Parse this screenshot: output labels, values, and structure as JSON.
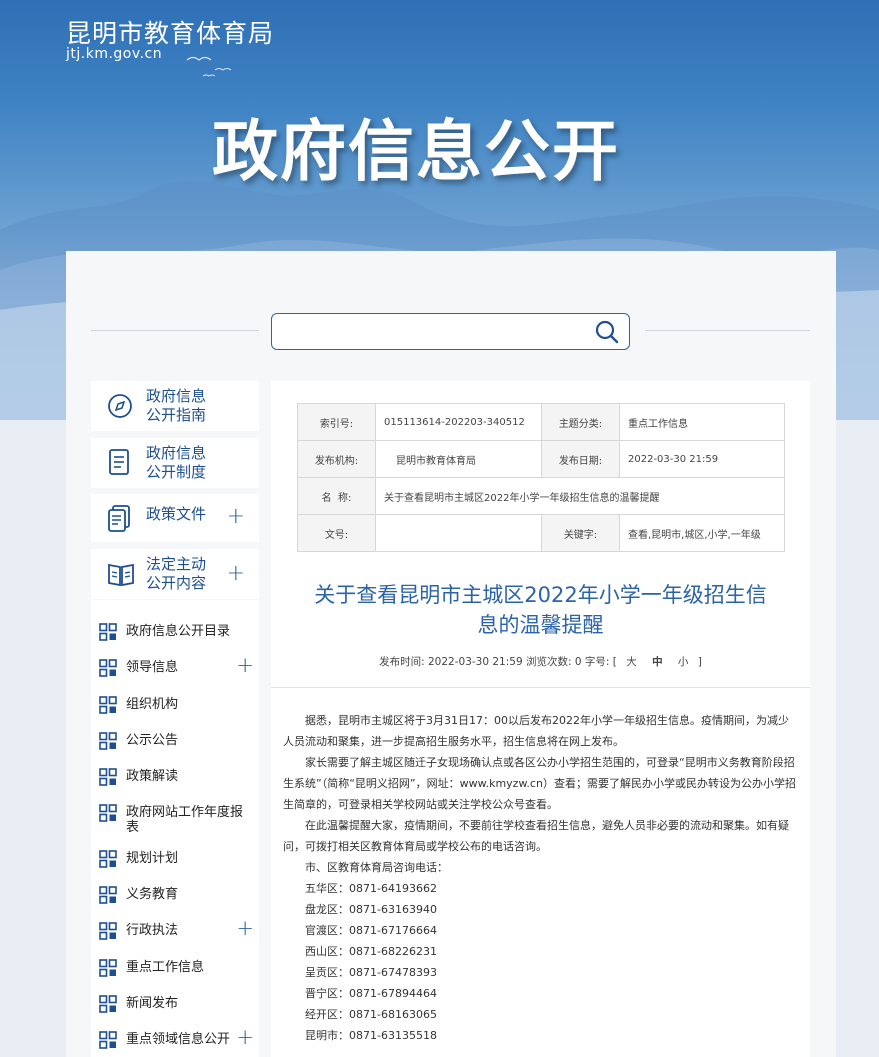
{
  "site": {
    "name": "昆明市教育体育局",
    "domain": "jtj.km.gov.cn"
  },
  "hero": {
    "title": "政府信息公开"
  },
  "search": {
    "placeholder": ""
  },
  "sidebar": {
    "cards": [
      {
        "label": "政府信息\n公开指南",
        "icon": "compass-icon",
        "has_plus": false
      },
      {
        "label": "政府信息\n公开制度",
        "icon": "document-icon",
        "has_plus": false
      },
      {
        "label": "政策文件",
        "icon": "policy-file-icon",
        "has_plus": true,
        "plus": "+"
      },
      {
        "label": "法定主动\n公开内容",
        "icon": "open-book-icon",
        "has_plus": true,
        "plus": "+"
      }
    ],
    "sub_items": [
      {
        "label": "政府信息公开目录",
        "plus": ""
      },
      {
        "label": "领导信息",
        "plus": "+"
      },
      {
        "label": "组织机构",
        "plus": ""
      },
      {
        "label": "公示公告",
        "plus": ""
      },
      {
        "label": "政策解读",
        "plus": ""
      },
      {
        "label": "政府网站工作年度报表",
        "plus": ""
      },
      {
        "label": "规划计划",
        "plus": ""
      },
      {
        "label": "义务教育",
        "plus": ""
      },
      {
        "label": "行政执法",
        "plus": "+"
      },
      {
        "label": "重点工作信息",
        "plus": ""
      },
      {
        "label": "新闻发布",
        "plus": ""
      },
      {
        "label": "重点领域信息公开",
        "plus": "+"
      }
    ]
  },
  "meta": {
    "index_label": "索引号:",
    "index_value": "015113614-202203-340512",
    "topic_label": "主题分类:",
    "topic_value": "重点工作信息",
    "org_label": "发布机构:",
    "org_value": "昆明市教育体育局",
    "date_label": "发布日期:",
    "date_value": "2022-03-30 21:59",
    "name_label": "名  称:",
    "name_value": "关于查看昆明市主城区2022年小学一年级招生信息的温馨提醒",
    "docno_label": "文号:",
    "docno_value": "",
    "keyword_label": "关键字:",
    "keyword_value": "查看,昆明市,城区,小学,一年级"
  },
  "article": {
    "title_line1": "关于查看昆明市主城区2022年小学一年级招生信",
    "title_line2": "息的温馨提醒",
    "pub_label": "发布时间:",
    "pub_time": "2022-03-30 21:59",
    "views_label": "浏览次数:",
    "views": "0",
    "fontsize_label": "字号:",
    "size_large": "大",
    "size_medium": "中",
    "size_small": "小",
    "paragraphs": [
      "据悉，昆明市主城区将于3月31日17：00以后发布2022年小学一年级招生信息。疫情期间，为减少人员流动和聚集，进一步提高招生服务水平，招生信息将在网上发布。",
      "家长需要了解主城区随迁子女现场确认点或各区公办小学招生范围的，可登录“昆明市义务教育阶段招生系统”（简称“昆明义招网”，网址：www.kmyzw.cn）查看；需要了解民办小学或民办转设为公办小学招生简章的，可登录相关学校网站或关注学校公众号查看。",
      "在此温馨提醒大家，疫情期间，不要前往学校查看招生信息，避免人员非必要的流动和聚集。如有疑问，可拨打相关区教育体育局或学校公布的电话咨询。"
    ],
    "phones_title": "市、区教育体育局咨询电话：",
    "phones": [
      "五华区：0871-64193662",
      "盘龙区：0871-63163940",
      "官渡区：0871-67176664",
      "西山区：0871-68226231",
      "呈贡区：0871-67478393",
      "晋宁区：0871-67894464",
      "经开区：0871-68163065",
      "昆明市：0871-63135518"
    ]
  }
}
